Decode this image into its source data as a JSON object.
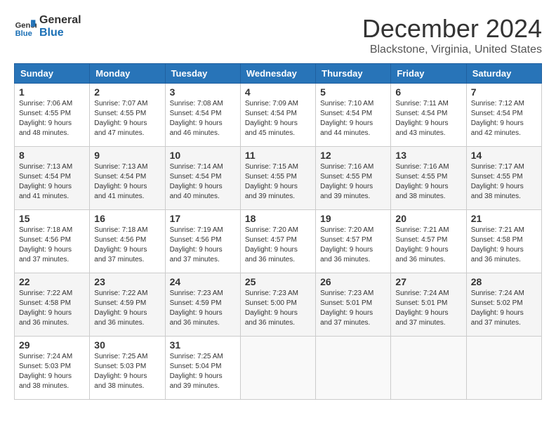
{
  "header": {
    "logo_line1": "General",
    "logo_line2": "Blue",
    "title": "December 2024",
    "subtitle": "Blackstone, Virginia, United States"
  },
  "calendar": {
    "days_of_week": [
      "Sunday",
      "Monday",
      "Tuesday",
      "Wednesday",
      "Thursday",
      "Friday",
      "Saturday"
    ],
    "weeks": [
      [
        null,
        null,
        null,
        null,
        null,
        null,
        null
      ]
    ],
    "cells": [
      {
        "date": "",
        "info": ""
      },
      {
        "date": "",
        "info": ""
      },
      {
        "date": "",
        "info": ""
      },
      {
        "date": "",
        "info": ""
      },
      {
        "date": "",
        "info": ""
      },
      {
        "date": "",
        "info": ""
      },
      {
        "date": "",
        "info": ""
      },
      {
        "date": "1",
        "sunrise": "Sunrise: 7:06 AM",
        "sunset": "Sunset: 4:55 PM",
        "daylight": "Daylight: 9 hours and 48 minutes."
      },
      {
        "date": "2",
        "sunrise": "Sunrise: 7:07 AM",
        "sunset": "Sunset: 4:55 PM",
        "daylight": "Daylight: 9 hours and 47 minutes."
      },
      {
        "date": "3",
        "sunrise": "Sunrise: 7:08 AM",
        "sunset": "Sunset: 4:54 PM",
        "daylight": "Daylight: 9 hours and 46 minutes."
      },
      {
        "date": "4",
        "sunrise": "Sunrise: 7:09 AM",
        "sunset": "Sunset: 4:54 PM",
        "daylight": "Daylight: 9 hours and 45 minutes."
      },
      {
        "date": "5",
        "sunrise": "Sunrise: 7:10 AM",
        "sunset": "Sunset: 4:54 PM",
        "daylight": "Daylight: 9 hours and 44 minutes."
      },
      {
        "date": "6",
        "sunrise": "Sunrise: 7:11 AM",
        "sunset": "Sunset: 4:54 PM",
        "daylight": "Daylight: 9 hours and 43 minutes."
      },
      {
        "date": "7",
        "sunrise": "Sunrise: 7:12 AM",
        "sunset": "Sunset: 4:54 PM",
        "daylight": "Daylight: 9 hours and 42 minutes."
      },
      {
        "date": "8",
        "sunrise": "Sunrise: 7:13 AM",
        "sunset": "Sunset: 4:54 PM",
        "daylight": "Daylight: 9 hours and 41 minutes."
      },
      {
        "date": "9",
        "sunrise": "Sunrise: 7:13 AM",
        "sunset": "Sunset: 4:54 PM",
        "daylight": "Daylight: 9 hours and 41 minutes."
      },
      {
        "date": "10",
        "sunrise": "Sunrise: 7:14 AM",
        "sunset": "Sunset: 4:54 PM",
        "daylight": "Daylight: 9 hours and 40 minutes."
      },
      {
        "date": "11",
        "sunrise": "Sunrise: 7:15 AM",
        "sunset": "Sunset: 4:55 PM",
        "daylight": "Daylight: 9 hours and 39 minutes."
      },
      {
        "date": "12",
        "sunrise": "Sunrise: 7:16 AM",
        "sunset": "Sunset: 4:55 PM",
        "daylight": "Daylight: 9 hours and 39 minutes."
      },
      {
        "date": "13",
        "sunrise": "Sunrise: 7:16 AM",
        "sunset": "Sunset: 4:55 PM",
        "daylight": "Daylight: 9 hours and 38 minutes."
      },
      {
        "date": "14",
        "sunrise": "Sunrise: 7:17 AM",
        "sunset": "Sunset: 4:55 PM",
        "daylight": "Daylight: 9 hours and 38 minutes."
      },
      {
        "date": "15",
        "sunrise": "Sunrise: 7:18 AM",
        "sunset": "Sunset: 4:56 PM",
        "daylight": "Daylight: 9 hours and 37 minutes."
      },
      {
        "date": "16",
        "sunrise": "Sunrise: 7:18 AM",
        "sunset": "Sunset: 4:56 PM",
        "daylight": "Daylight: 9 hours and 37 minutes."
      },
      {
        "date": "17",
        "sunrise": "Sunrise: 7:19 AM",
        "sunset": "Sunset: 4:56 PM",
        "daylight": "Daylight: 9 hours and 37 minutes."
      },
      {
        "date": "18",
        "sunrise": "Sunrise: 7:20 AM",
        "sunset": "Sunset: 4:57 PM",
        "daylight": "Daylight: 9 hours and 36 minutes."
      },
      {
        "date": "19",
        "sunrise": "Sunrise: 7:20 AM",
        "sunset": "Sunset: 4:57 PM",
        "daylight": "Daylight: 9 hours and 36 minutes."
      },
      {
        "date": "20",
        "sunrise": "Sunrise: 7:21 AM",
        "sunset": "Sunset: 4:57 PM",
        "daylight": "Daylight: 9 hours and 36 minutes."
      },
      {
        "date": "21",
        "sunrise": "Sunrise: 7:21 AM",
        "sunset": "Sunset: 4:58 PM",
        "daylight": "Daylight: 9 hours and 36 minutes."
      },
      {
        "date": "22",
        "sunrise": "Sunrise: 7:22 AM",
        "sunset": "Sunset: 4:58 PM",
        "daylight": "Daylight: 9 hours and 36 minutes."
      },
      {
        "date": "23",
        "sunrise": "Sunrise: 7:22 AM",
        "sunset": "Sunset: 4:59 PM",
        "daylight": "Daylight: 9 hours and 36 minutes."
      },
      {
        "date": "24",
        "sunrise": "Sunrise: 7:23 AM",
        "sunset": "Sunset: 4:59 PM",
        "daylight": "Daylight: 9 hours and 36 minutes."
      },
      {
        "date": "25",
        "sunrise": "Sunrise: 7:23 AM",
        "sunset": "Sunset: 5:00 PM",
        "daylight": "Daylight: 9 hours and 36 minutes."
      },
      {
        "date": "26",
        "sunrise": "Sunrise: 7:23 AM",
        "sunset": "Sunset: 5:01 PM",
        "daylight": "Daylight: 9 hours and 37 minutes."
      },
      {
        "date": "27",
        "sunrise": "Sunrise: 7:24 AM",
        "sunset": "Sunset: 5:01 PM",
        "daylight": "Daylight: 9 hours and 37 minutes."
      },
      {
        "date": "28",
        "sunrise": "Sunrise: 7:24 AM",
        "sunset": "Sunset: 5:02 PM",
        "daylight": "Daylight: 9 hours and 37 minutes."
      },
      {
        "date": "29",
        "sunrise": "Sunrise: 7:24 AM",
        "sunset": "Sunset: 5:03 PM",
        "daylight": "Daylight: 9 hours and 38 minutes."
      },
      {
        "date": "30",
        "sunrise": "Sunrise: 7:25 AM",
        "sunset": "Sunset: 5:03 PM",
        "daylight": "Daylight: 9 hours and 38 minutes."
      },
      {
        "date": "31",
        "sunrise": "Sunrise: 7:25 AM",
        "sunset": "Sunset: 5:04 PM",
        "daylight": "Daylight: 9 hours and 39 minutes."
      },
      {
        "date": "",
        "info": ""
      },
      {
        "date": "",
        "info": ""
      },
      {
        "date": "",
        "info": ""
      },
      {
        "date": "",
        "info": ""
      }
    ]
  }
}
